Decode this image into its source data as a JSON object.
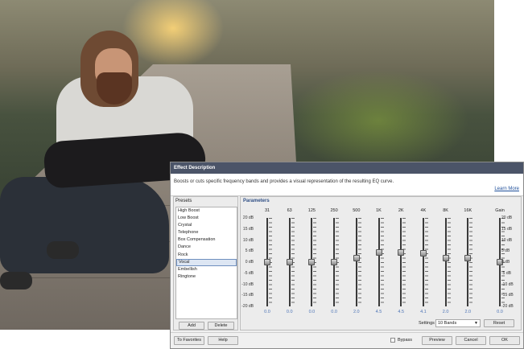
{
  "dialog": {
    "title": "Effect Description",
    "description": "Boosts or cuts specific frequency bands and provides a visual representation of the resulting EQ curve.",
    "learn_more": "Learn More"
  },
  "presets": {
    "header": "Presets",
    "items": [
      "High Boost",
      "Low Boost",
      "Crystal",
      "Telephone",
      "Box Compensation",
      "Dance",
      "Rock",
      "Vocal",
      "Embellish",
      "Ringtone"
    ],
    "selected": "Vocal",
    "add_label": "Add",
    "delete_label": "Delete"
  },
  "parameters": {
    "header": "Parameters",
    "db_scale": [
      "20 dB",
      "15 dB",
      "10 dB",
      "5 dB",
      "0 dB",
      "-5 dB",
      "-10 dB",
      "-15 dB",
      "-20 dB"
    ],
    "gain_label": "Gain",
    "gain_value": "0.0",
    "bands": [
      {
        "label": "31",
        "value": "0.0"
      },
      {
        "label": "63",
        "value": "0.0"
      },
      {
        "label": "125",
        "value": "0.0"
      },
      {
        "label": "250",
        "value": "0.0"
      },
      {
        "label": "500",
        "value": "2.0"
      },
      {
        "label": "1K",
        "value": "4.5"
      },
      {
        "label": "2K",
        "value": "4.5"
      },
      {
        "label": "4K",
        "value": "4.1"
      },
      {
        "label": "8K",
        "value": "2.0"
      },
      {
        "label": "16K",
        "value": "2.0"
      }
    ],
    "settings_label": "Settings",
    "settings_value": "10 Bands",
    "reset_label": "Reset"
  },
  "footer": {
    "favorites_label": "To Favorites",
    "help_label": "Help",
    "bypass_label": "Bypass",
    "preview_label": "Preview",
    "cancel_label": "Cancel",
    "ok_label": "OK"
  }
}
